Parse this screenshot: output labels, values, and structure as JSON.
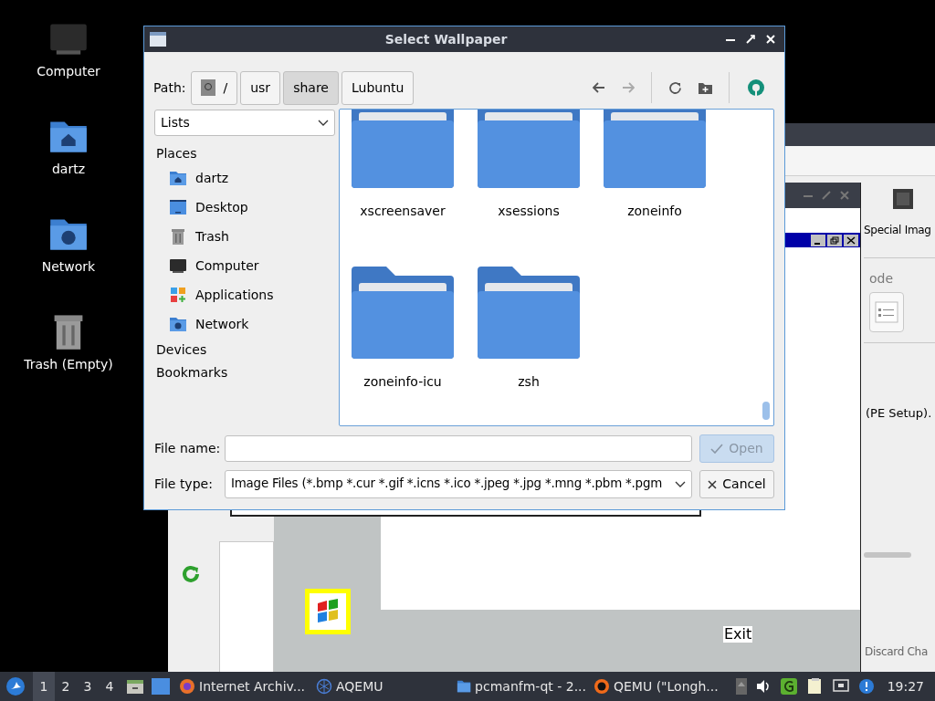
{
  "desktop_icons": [
    {
      "label": "Computer",
      "kind": "computer"
    },
    {
      "label": "dartz",
      "kind": "home"
    },
    {
      "label": "Network",
      "kind": "network"
    },
    {
      "label": "Trash (Empty)",
      "kind": "trash"
    }
  ],
  "back_window": {
    "item_label": "Special Imag",
    "section_heading": "ode",
    "description": "(PE Setup).",
    "button": "Discard Cha"
  },
  "qemu_window": {
    "exit_label": "Exit"
  },
  "dialog": {
    "title": "Select Wallpaper",
    "path_label": "Path:",
    "path_segments": [
      {
        "label": "/",
        "selected": false,
        "kind": "root"
      },
      {
        "label": "usr",
        "selected": false
      },
      {
        "label": "share",
        "selected": true
      },
      {
        "label": "Lubuntu",
        "selected": false
      }
    ],
    "view_mode": "Lists",
    "places_heading": "Places",
    "places": [
      {
        "label": "dartz",
        "kind": "home"
      },
      {
        "label": "Desktop",
        "kind": "desktop"
      },
      {
        "label": "Trash",
        "kind": "trash"
      },
      {
        "label": "Computer",
        "kind": "computer"
      },
      {
        "label": "Applications",
        "kind": "apps"
      },
      {
        "label": "Network",
        "kind": "network"
      }
    ],
    "devices_heading": "Devices",
    "bookmarks_heading": "Bookmarks",
    "files": [
      {
        "name": "xscreensaver"
      },
      {
        "name": "xsessions"
      },
      {
        "name": "zoneinfo"
      },
      {
        "name": "zoneinfo-icu"
      },
      {
        "name": "zsh"
      }
    ],
    "file_name_label": "File name:",
    "open_button": {
      "label": "Open",
      "disabled": true
    },
    "file_type_label": "File type:",
    "file_type": "Image Files (*.bmp *.cur *.gif *.icns *.ico *.jpeg *.jpg *.mng *.pbm *.pgm",
    "cancel_button": "Cancel"
  },
  "taskbar": {
    "desktops": [
      {
        "label": "1",
        "selected": true
      },
      {
        "label": "2",
        "selected": false
      },
      {
        "label": "3",
        "selected": false
      },
      {
        "label": "4",
        "selected": false
      }
    ],
    "tasks": [
      {
        "label": "Internet Archiv...",
        "kind": "browser"
      },
      {
        "label": "AQEMU",
        "kind": "aqemu"
      },
      {
        "label": "pcmanfm-qt - 2...",
        "kind": "folder"
      },
      {
        "label": "QEMU (\"Longh...",
        "kind": "qemu"
      }
    ],
    "clock": "19:27"
  }
}
